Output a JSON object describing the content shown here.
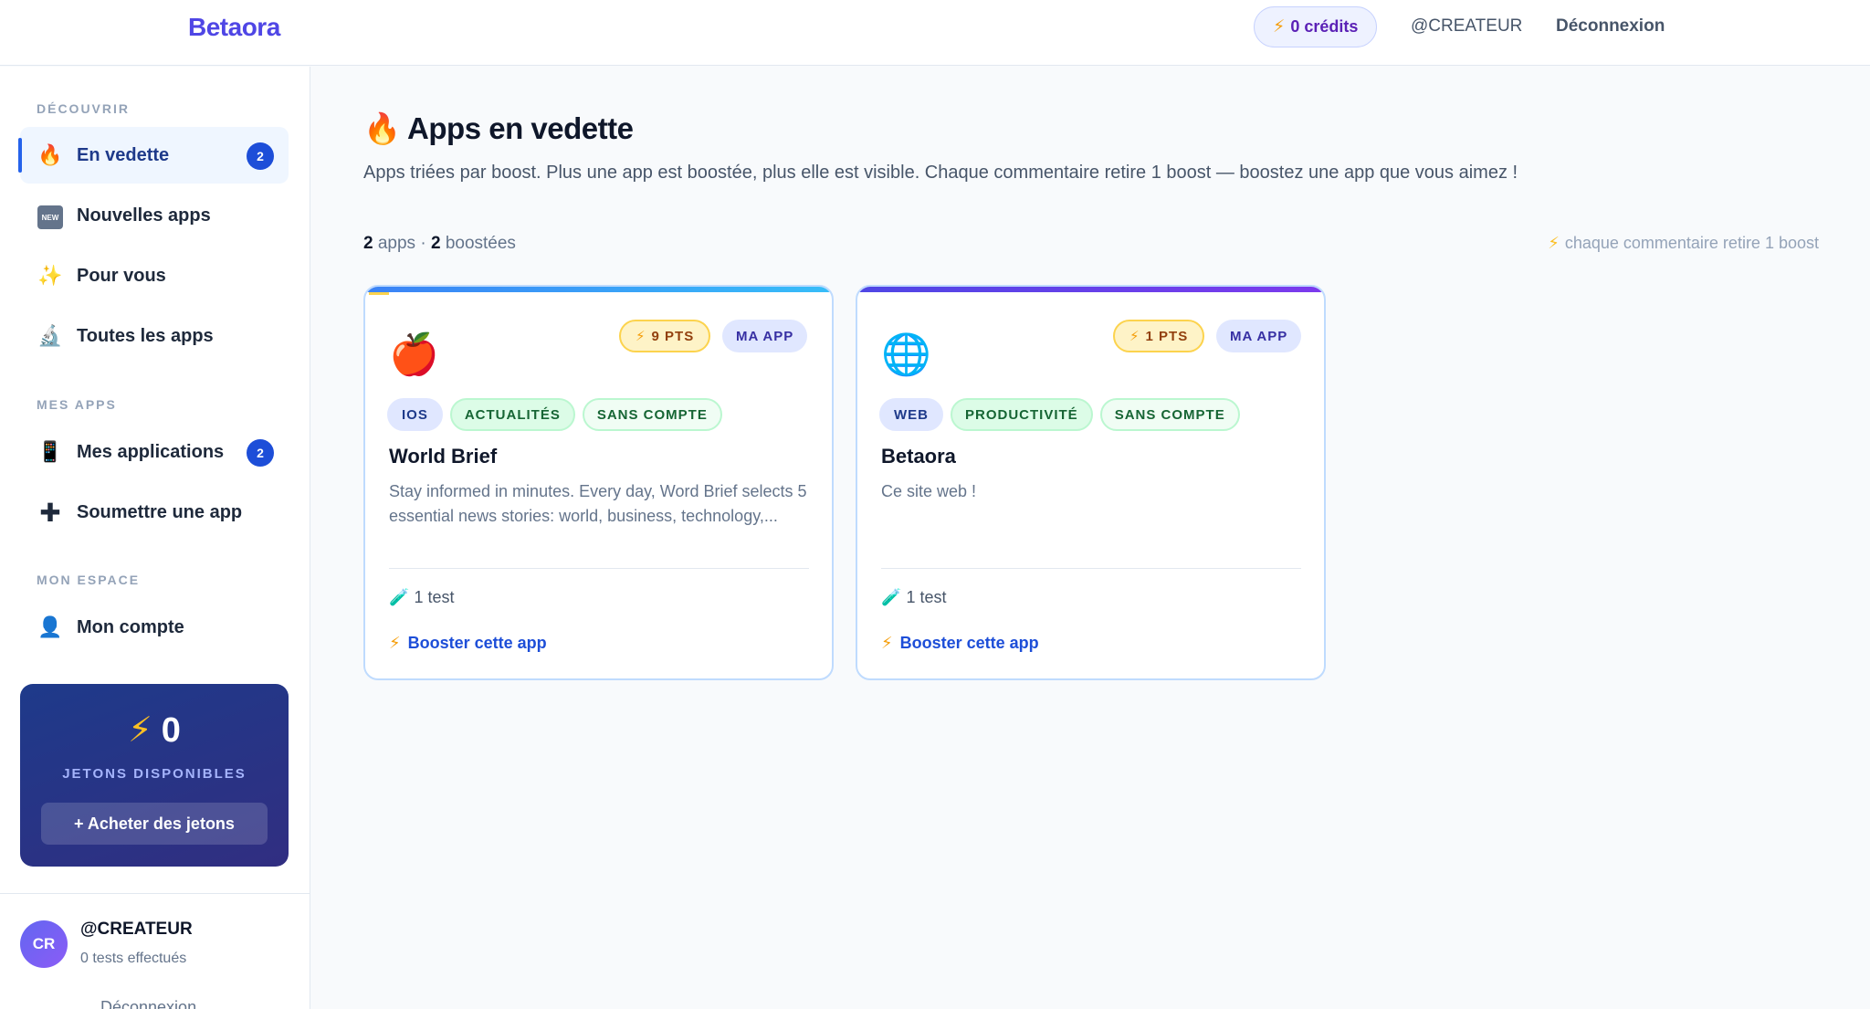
{
  "header": {
    "brand": "Betaora",
    "credits": "0 crédits",
    "username": "@CREATEUR",
    "logout": "Déconnexion"
  },
  "sidebar": {
    "section_discover": "DÉCOUVRIR",
    "section_myapps": "MES APPS",
    "section_space": "MON ESPACE",
    "items": [
      {
        "label": "En vedette",
        "icon": "fire-icon",
        "badge": "2"
      },
      {
        "label": "Nouvelles apps",
        "icon": "new-icon"
      },
      {
        "label": "Pour vous",
        "icon": "sparkles-icon"
      },
      {
        "label": "Toutes les apps",
        "icon": "microscope-icon"
      },
      {
        "label": "Mes applications",
        "icon": "phone-icon",
        "badge": "2"
      },
      {
        "label": "Soumettre une app",
        "icon": "plus-icon"
      },
      {
        "label": "Mon compte",
        "icon": "user-icon"
      }
    ],
    "tokens": {
      "value": "0",
      "label": "JETONS DISPONIBLES",
      "buy_button": "+ Acheter des jetons"
    },
    "user": {
      "initials": "CR",
      "name": "@CREATEUR",
      "subtitle": "0 tests effectués",
      "logout": "Déconnexion"
    }
  },
  "main": {
    "title": "Apps en vedette",
    "subtitle": "Apps triées par boost. Plus une app est boostée, plus elle est visible. Chaque commentaire retire 1 boost — boostez une app que vous aimez !",
    "stats": {
      "apps_count": "2",
      "apps_label": "apps",
      "sep": "·",
      "boosted_count": "2",
      "boosted_label": "boostées"
    },
    "hint": "chaque commentaire retire 1 boost",
    "cards": [
      {
        "name": "World Brief",
        "icon": "apple-icon",
        "points": "9 PTS",
        "mine": "MA APP",
        "tags": [
          "IOS",
          "ACTUALITÉS",
          "SANS COMPTE"
        ],
        "description": "Stay informed in minutes. Every day, Word Brief selects 5 essential news stories: world, business, technology,...",
        "tests": "1 test",
        "boost": "Booster cette app"
      },
      {
        "name": "Betaora",
        "icon": "globe-icon",
        "points": "1 PTS",
        "mine": "MA APP",
        "tags": [
          "WEB",
          "PRODUCTIVITÉ",
          "SANS COMPTE"
        ],
        "description": "Ce site web !",
        "tests": "1 test",
        "boost": "Booster cette app"
      }
    ]
  },
  "colors": {
    "accent": "#2563eb",
    "brand": "#4f46e5",
    "points": "#f59e0b"
  }
}
